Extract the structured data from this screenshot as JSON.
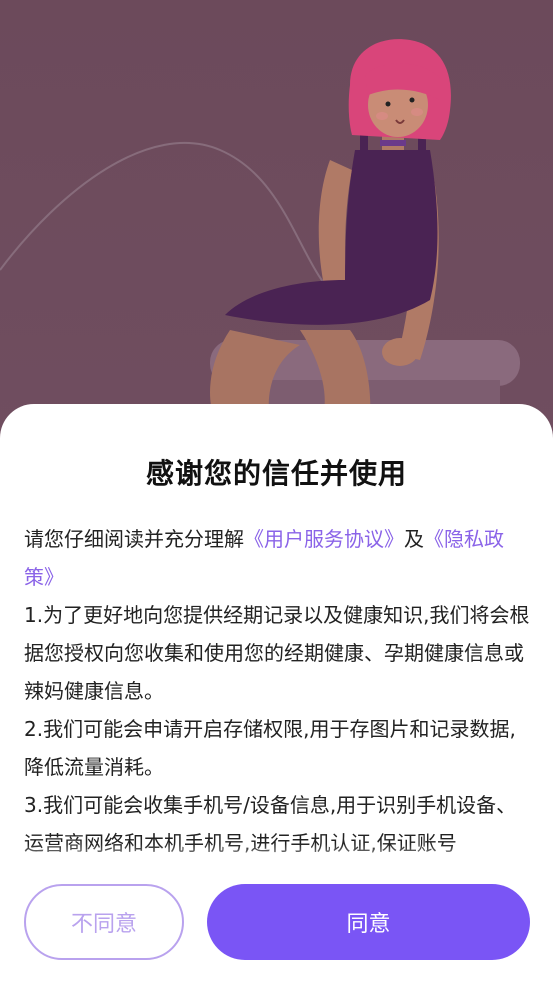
{
  "dialog": {
    "title": "感谢您的信任并使用",
    "intro_prefix": "请您仔细阅读并充分理解",
    "user_agreement_link": "《用户服务协议》",
    "and_text": "及",
    "privacy_link": "《隐私政策》",
    "paragraphs": [
      " 1.为了更好地向您提供经期记录以及健康知识,我们将会根据您授权向您收集和使用您的经期健康、孕期健康信息或辣妈健康信息。",
      " 2.我们可能会申请开启存储权限,用于存图片和记录数据,降低流量消耗。",
      " 3.我们可能会收集手机号/设备信息,用于识别手机设备、运营商网络和本机手机号,进行手机认证,保证账号"
    ],
    "disagree_label": "不同意",
    "agree_label": "同意"
  },
  "colors": {
    "accent": "#7a55f5",
    "link": "#8a63e8",
    "disagree_border": "#b9a2ee",
    "background_overlay": "#6e4c5d"
  }
}
